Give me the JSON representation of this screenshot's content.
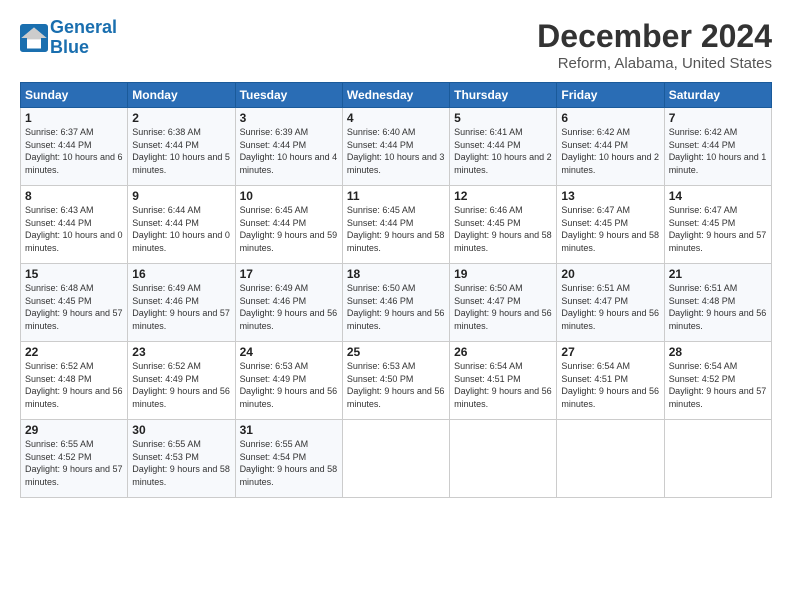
{
  "logo": {
    "line1": "General",
    "line2": "Blue"
  },
  "title": "December 2024",
  "location": "Reform, Alabama, United States",
  "days_of_week": [
    "Sunday",
    "Monday",
    "Tuesday",
    "Wednesday",
    "Thursday",
    "Friday",
    "Saturday"
  ],
  "weeks": [
    [
      {
        "day": "1",
        "sunrise": "6:37 AM",
        "sunset": "4:44 PM",
        "daylight": "10 hours and 6 minutes."
      },
      {
        "day": "2",
        "sunrise": "6:38 AM",
        "sunset": "4:44 PM",
        "daylight": "10 hours and 5 minutes."
      },
      {
        "day": "3",
        "sunrise": "6:39 AM",
        "sunset": "4:44 PM",
        "daylight": "10 hours and 4 minutes."
      },
      {
        "day": "4",
        "sunrise": "6:40 AM",
        "sunset": "4:44 PM",
        "daylight": "10 hours and 3 minutes."
      },
      {
        "day": "5",
        "sunrise": "6:41 AM",
        "sunset": "4:44 PM",
        "daylight": "10 hours and 2 minutes."
      },
      {
        "day": "6",
        "sunrise": "6:42 AM",
        "sunset": "4:44 PM",
        "daylight": "10 hours and 2 minutes."
      },
      {
        "day": "7",
        "sunrise": "6:42 AM",
        "sunset": "4:44 PM",
        "daylight": "10 hours and 1 minute."
      }
    ],
    [
      {
        "day": "8",
        "sunrise": "6:43 AM",
        "sunset": "4:44 PM",
        "daylight": "10 hours and 0 minutes."
      },
      {
        "day": "9",
        "sunrise": "6:44 AM",
        "sunset": "4:44 PM",
        "daylight": "10 hours and 0 minutes."
      },
      {
        "day": "10",
        "sunrise": "6:45 AM",
        "sunset": "4:44 PM",
        "daylight": "9 hours and 59 minutes."
      },
      {
        "day": "11",
        "sunrise": "6:45 AM",
        "sunset": "4:44 PM",
        "daylight": "9 hours and 58 minutes."
      },
      {
        "day": "12",
        "sunrise": "6:46 AM",
        "sunset": "4:45 PM",
        "daylight": "9 hours and 58 minutes."
      },
      {
        "day": "13",
        "sunrise": "6:47 AM",
        "sunset": "4:45 PM",
        "daylight": "9 hours and 58 minutes."
      },
      {
        "day": "14",
        "sunrise": "6:47 AM",
        "sunset": "4:45 PM",
        "daylight": "9 hours and 57 minutes."
      }
    ],
    [
      {
        "day": "15",
        "sunrise": "6:48 AM",
        "sunset": "4:45 PM",
        "daylight": "9 hours and 57 minutes."
      },
      {
        "day": "16",
        "sunrise": "6:49 AM",
        "sunset": "4:46 PM",
        "daylight": "9 hours and 57 minutes."
      },
      {
        "day": "17",
        "sunrise": "6:49 AM",
        "sunset": "4:46 PM",
        "daylight": "9 hours and 56 minutes."
      },
      {
        "day": "18",
        "sunrise": "6:50 AM",
        "sunset": "4:46 PM",
        "daylight": "9 hours and 56 minutes."
      },
      {
        "day": "19",
        "sunrise": "6:50 AM",
        "sunset": "4:47 PM",
        "daylight": "9 hours and 56 minutes."
      },
      {
        "day": "20",
        "sunrise": "6:51 AM",
        "sunset": "4:47 PM",
        "daylight": "9 hours and 56 minutes."
      },
      {
        "day": "21",
        "sunrise": "6:51 AM",
        "sunset": "4:48 PM",
        "daylight": "9 hours and 56 minutes."
      }
    ],
    [
      {
        "day": "22",
        "sunrise": "6:52 AM",
        "sunset": "4:48 PM",
        "daylight": "9 hours and 56 minutes."
      },
      {
        "day": "23",
        "sunrise": "6:52 AM",
        "sunset": "4:49 PM",
        "daylight": "9 hours and 56 minutes."
      },
      {
        "day": "24",
        "sunrise": "6:53 AM",
        "sunset": "4:49 PM",
        "daylight": "9 hours and 56 minutes."
      },
      {
        "day": "25",
        "sunrise": "6:53 AM",
        "sunset": "4:50 PM",
        "daylight": "9 hours and 56 minutes."
      },
      {
        "day": "26",
        "sunrise": "6:54 AM",
        "sunset": "4:51 PM",
        "daylight": "9 hours and 56 minutes."
      },
      {
        "day": "27",
        "sunrise": "6:54 AM",
        "sunset": "4:51 PM",
        "daylight": "9 hours and 56 minutes."
      },
      {
        "day": "28",
        "sunrise": "6:54 AM",
        "sunset": "4:52 PM",
        "daylight": "9 hours and 57 minutes."
      }
    ],
    [
      {
        "day": "29",
        "sunrise": "6:55 AM",
        "sunset": "4:52 PM",
        "daylight": "9 hours and 57 minutes."
      },
      {
        "day": "30",
        "sunrise": "6:55 AM",
        "sunset": "4:53 PM",
        "daylight": "9 hours and 58 minutes."
      },
      {
        "day": "31",
        "sunrise": "6:55 AM",
        "sunset": "4:54 PM",
        "daylight": "9 hours and 58 minutes."
      },
      null,
      null,
      null,
      null
    ]
  ],
  "labels": {
    "sunrise_prefix": "Sunrise: ",
    "sunset_prefix": "Sunset: ",
    "daylight_prefix": "Daylight: "
  }
}
